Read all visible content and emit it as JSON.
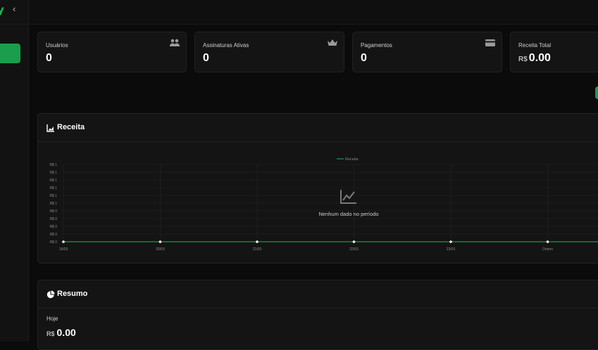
{
  "brand": {
    "glyph": "y",
    "collapse_glyph": "‹"
  },
  "cards": [
    {
      "label": "Usuários",
      "value": "0",
      "currency": "",
      "icon": "users-icon"
    },
    {
      "label": "Assinaturas Ativas",
      "value": "0",
      "currency": "",
      "icon": "crown-icon"
    },
    {
      "label": "Pagamentos",
      "value": "0",
      "currency": "",
      "icon": "credit-card-icon"
    },
    {
      "label": "Receita Total",
      "value": "0.00",
      "currency": "R$",
      "icon": "dollar-icon"
    }
  ],
  "revenue_panel": {
    "title": "Receita",
    "icon": "area-chart-icon",
    "empty_message": "Nenhum dado no período",
    "empty_icon": "line-chart-icon"
  },
  "chart_data": {
    "type": "line",
    "legend": [
      "Receita"
    ],
    "categories": [
      "19/03",
      "20/03",
      "21/03",
      "22/03",
      "23/03",
      "Ontem"
    ],
    "series": [
      {
        "name": "Receita",
        "values": [
          0,
          0,
          0,
          0,
          0,
          0
        ],
        "color": "#1db954"
      }
    ],
    "y_tick_labels": [
      "R$ 1",
      "R$ 1",
      "R$ 1",
      "R$ 1",
      "R$ 1",
      "R$ 1",
      "R$ 0",
      "R$ 0",
      "R$ 0",
      "R$ 0",
      "R$ 0"
    ],
    "grid": true
  },
  "summary_panel": {
    "title": "Resumo",
    "icon": "pie-chart-icon",
    "today_label": "Hoje",
    "today_currency": "R$",
    "today_value": "0.00"
  },
  "colors": {
    "accent": "#1db954",
    "panel": "#141414",
    "background": "#0b0b0b"
  }
}
